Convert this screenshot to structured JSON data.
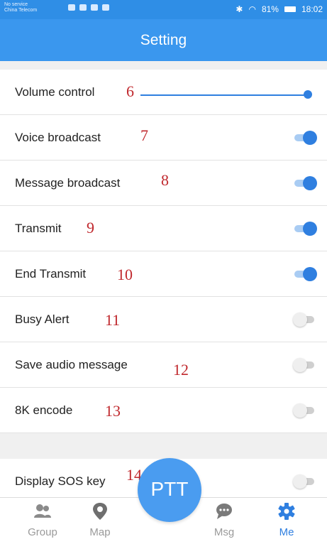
{
  "status_bar": {
    "carrier_line1": "No service",
    "carrier_line2": "China Telecom",
    "battery": "81%",
    "time": "18:02"
  },
  "header": {
    "title": "Setting"
  },
  "settings": {
    "volume": {
      "label": "Volume control",
      "num": "6",
      "level": 1.0
    },
    "items": [
      {
        "label": "Voice broadcast",
        "num": "7",
        "on": true
      },
      {
        "label": "Message broadcast",
        "num": "8",
        "on": true
      },
      {
        "label": "Transmit",
        "num": "9",
        "on": true
      },
      {
        "label": "End Transmit",
        "num": "10",
        "on": true
      },
      {
        "label": "Busy Alert",
        "num": "11",
        "on": false
      },
      {
        "label": "Save audio message",
        "num": "12",
        "on": false
      },
      {
        "label": "8K encode",
        "num": "13",
        "on": false
      }
    ],
    "sos": {
      "label": "Display SOS key",
      "num": "14",
      "on": false
    }
  },
  "ptt_button": {
    "label": "PTT"
  },
  "bottom_nav": {
    "tabs": [
      {
        "label": "Group",
        "icon": "group-icon"
      },
      {
        "label": "Map",
        "icon": "map-pin-icon"
      },
      {
        "label": "Msg",
        "icon": "chat-icon"
      },
      {
        "label": "Me",
        "icon": "gear-icon",
        "active": true
      }
    ]
  },
  "colors": {
    "accent": "#2f7fe0",
    "header": "#3a97ee",
    "annotation": "#c0282d"
  }
}
